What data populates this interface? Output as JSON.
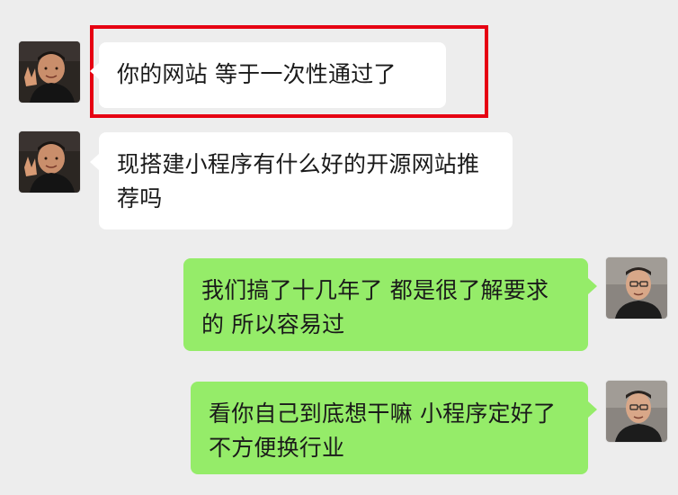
{
  "chat": {
    "messages": [
      {
        "side": "left",
        "text": "你的网站 等于一次性通过了"
      },
      {
        "side": "left",
        "text": "现搭建小程序有什么好的开源网站推荐吗"
      },
      {
        "side": "right",
        "text": "我们搞了十几年了 都是很了解要求的 所以容易过"
      },
      {
        "side": "right",
        "text": "看你自己到底想干嘛 小程序定好了不方便换行业"
      }
    ]
  },
  "colors": {
    "background": "#ededed",
    "left_bubble": "#ffffff",
    "right_bubble": "#95ec69",
    "highlight": "#e60012"
  }
}
